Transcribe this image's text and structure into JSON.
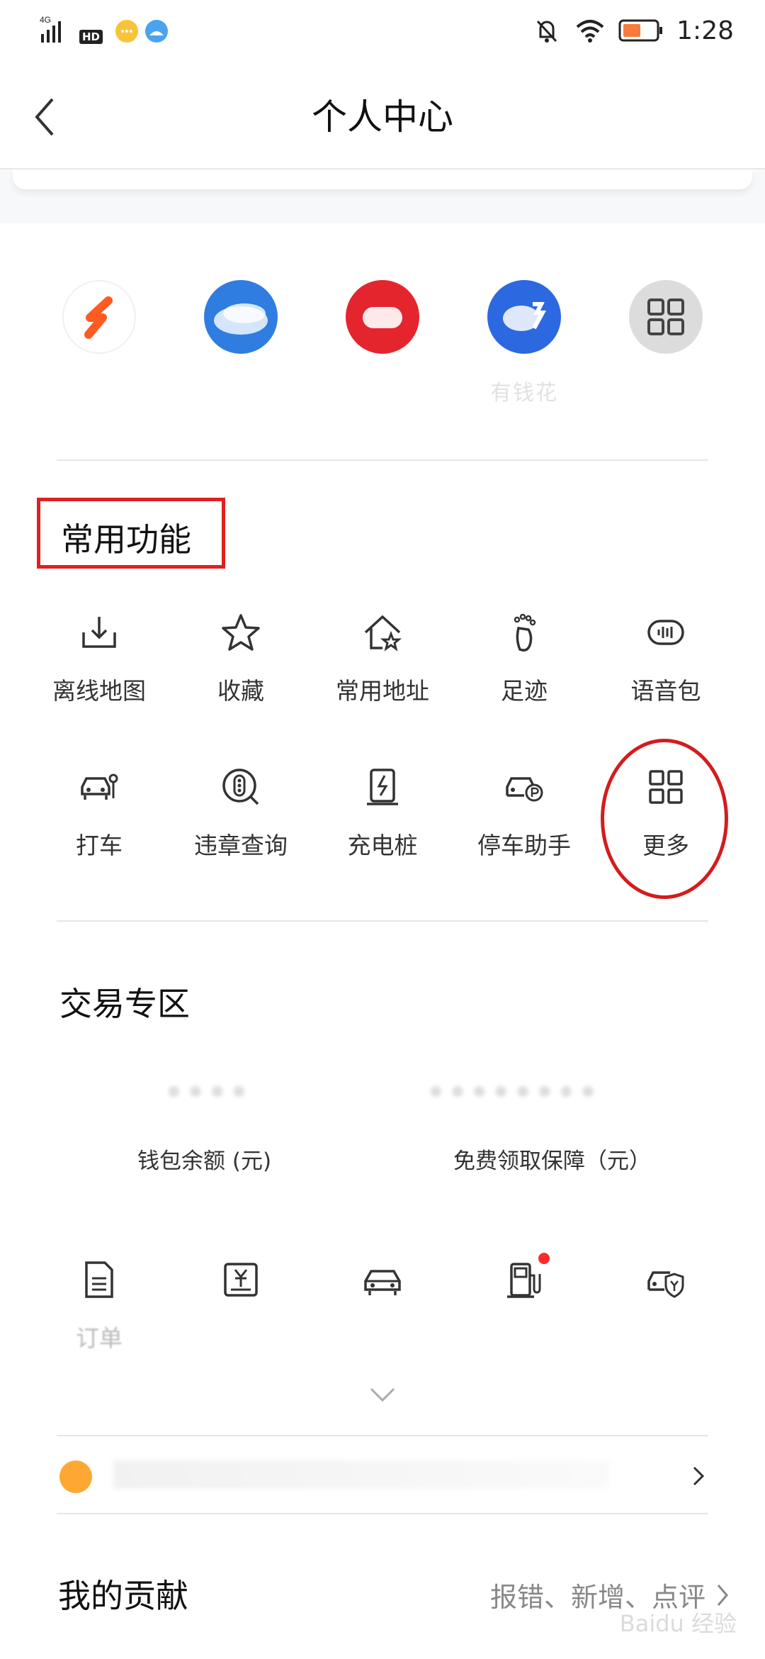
{
  "status_bar": {
    "network": "4G",
    "hd": "HD",
    "time": "1:28"
  },
  "header": {
    "title": "个人中心"
  },
  "shortcuts": [
    {
      "color": "#ff5a1f",
      "icon": "s-logo-icon"
    },
    {
      "color": "#2f7de0",
      "icon": "wave-app-icon"
    },
    {
      "color": "#e4252e",
      "icon": "red-app-icon"
    },
    {
      "color": "#2c68e0",
      "icon": "blue-app-icon",
      "label": "有钱花"
    },
    {
      "color": "#d8d8d8",
      "icon": "grid-icon"
    }
  ],
  "common": {
    "title": "常用功能",
    "items": [
      {
        "label": "离线地图",
        "icon": "download-tray-icon"
      },
      {
        "label": "收藏",
        "icon": "star-icon"
      },
      {
        "label": "常用地址",
        "icon": "home-star-icon"
      },
      {
        "label": "足迹",
        "icon": "footprint-icon"
      },
      {
        "label": "语音包",
        "icon": "voice-pack-icon"
      },
      {
        "label": "打车",
        "icon": "taxi-icon"
      },
      {
        "label": "违章查询",
        "icon": "traffic-light-icon"
      },
      {
        "label": "充电桩",
        "icon": "charging-pile-icon"
      },
      {
        "label": "停车助手",
        "icon": "parking-car-icon"
      },
      {
        "label": "更多",
        "icon": "grid-icon"
      }
    ]
  },
  "trade": {
    "title": "交易专区",
    "wallet_label": "钱包余额 (元)",
    "guarantee_label": "免费领取保障（元）",
    "items": [
      {
        "label": "订单",
        "icon": "document-icon"
      },
      {
        "label": "",
        "icon": "yuan-card-icon"
      },
      {
        "label": "",
        "icon": "car-icon"
      },
      {
        "label": "",
        "icon": "fuel-pump-icon"
      },
      {
        "label": "",
        "icon": "car-shield-icon"
      }
    ]
  },
  "contribution": {
    "title": "我的贡献",
    "right_text": "报错、新增、点评"
  },
  "watermark": "Baidu 经验"
}
